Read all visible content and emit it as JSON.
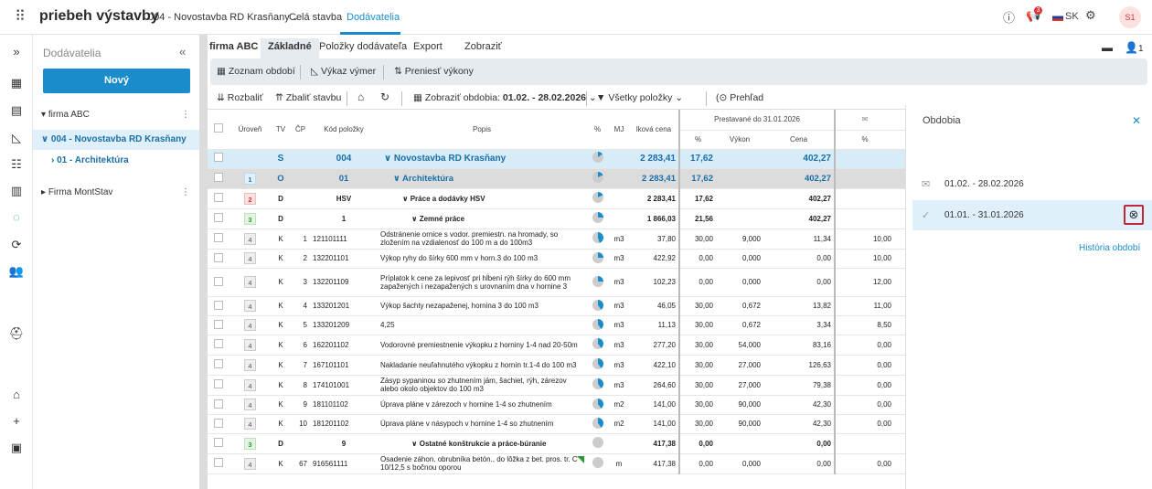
{
  "app": {
    "brand": "priebeh výstavby",
    "project": "004 - Novostavba RD Krasňany",
    "nav": [
      "Celá stavba",
      "Dodávatelia"
    ],
    "active_nav": "Dodávatelia",
    "badge_count": "3",
    "lang": "SK",
    "user": "S1"
  },
  "tree": {
    "header": "Dodávatelia",
    "new_button": "Nový",
    "nodes": [
      {
        "label": "firma ABC",
        "arrow": "▾",
        "dots": "⋮"
      },
      {
        "label": "004 - Novostavba RD Krasňany",
        "arrow": "∨"
      },
      {
        "label": "01 - Architektúra",
        "arrow": "›"
      },
      {
        "label": "Firma MontStav",
        "arrow": "▸",
        "dots": "⋮"
      }
    ]
  },
  "tabs": {
    "company": "firma ABC",
    "items": [
      "Základné",
      "Položky dodávateľa",
      "Export",
      "Zobraziť"
    ],
    "share_count": "1"
  },
  "toolbar1": {
    "periods": "Zoznam období",
    "measure": "Výkaz výmer",
    "transfer": "Preniesť výkony"
  },
  "toolbar2": {
    "expand": "Rozbaliť",
    "collapse": "Zbaliť stavbu",
    "show_period": "Zobraziť obdobia:",
    "period_value": "01.02. - 28.02.2026",
    "all_items": "Všetky položky",
    "overview": "Prehľad"
  },
  "table": {
    "headers": {
      "level": "Úroveň",
      "tv": "TV",
      "cp": "ČP",
      "code": "Kód položky",
      "desc": "Popis",
      "pct": "%",
      "mj": "MJ",
      "price_total": "lková cena",
      "performed_group": "Prestavané do 31.01.2026",
      "perf_pct": "%",
      "perf_out": "Výkon",
      "perf_price": "Cena",
      "next_pct": "%"
    },
    "rows": [
      {
        "type": "s",
        "lvl": "",
        "tv": "S",
        "cp": "",
        "code": "004",
        "desc": "Novostavba RD Krasňany",
        "pie": "p1",
        "mj": "",
        "price": "2 283,41",
        "pct": "17,62",
        "out": "",
        "cena": "402,27",
        "next": ""
      },
      {
        "type": "o",
        "lvl": "1",
        "lvlc": "l1",
        "tv": "O",
        "cp": "",
        "code": "01",
        "desc": "Architektúra",
        "pie": "p2",
        "mj": "",
        "price": "2 283,41",
        "pct": "17,62",
        "out": "",
        "cena": "402,27",
        "next": ""
      },
      {
        "type": "b",
        "lvl": "2",
        "lvlc": "l2",
        "tv": "D",
        "cp": "",
        "code": "HSV",
        "desc": "Práce a dodávky HSV",
        "pie": "p2",
        "mj": "",
        "price": "2 283,41",
        "pct": "17,62",
        "out": "",
        "cena": "402,27",
        "next": ""
      },
      {
        "type": "b",
        "lvl": "3",
        "lvlc": "l3",
        "tv": "D",
        "cp": "",
        "code": "1",
        "desc": "Zemné práce",
        "pie": "p3",
        "mj": "",
        "price": "1 866,03",
        "pct": "21,56",
        "out": "",
        "cena": "402,27",
        "next": ""
      },
      {
        "type": "k",
        "lvl": "4",
        "lvlc": "",
        "tv": "K",
        "cp": "1",
        "code": "121101111",
        "desc": "Odstránenie ornice s vodor. premiestn. na hromady, so zložením na vzdialenosť do 100 m a do 100m3",
        "pie": "p4",
        "mj": "m3",
        "price": "37,80",
        "pct": "30,00",
        "out": "9,000",
        "cena": "11,34",
        "next": "10,00"
      },
      {
        "type": "k",
        "lvl": "4",
        "lvlc": "",
        "tv": "K",
        "cp": "2",
        "code": "132201101",
        "desc": "Výkop ryhy do šírky 600 mm v horn.3 do 100 m3",
        "pie": "p3",
        "mj": "m3",
        "price": "422,92",
        "pct": "0,00",
        "out": "0,000",
        "cena": "0,00",
        "next": "10,00"
      },
      {
        "type": "k",
        "lvl": "4",
        "lvlc": "",
        "tv": "K",
        "cp": "3",
        "code": "132201109",
        "desc": "Príplatok k cene za lepivosť pri hĺbení rýh šírky do 600 mm zapažených i nezapažených s urovnaním dna v hornine 3",
        "pie": "p3",
        "mj": "m3",
        "price": "102,23",
        "pct": "0,00",
        "out": "0,000",
        "cena": "0,00",
        "next": "12,00"
      },
      {
        "type": "k",
        "lvl": "4",
        "lvlc": "",
        "tv": "K",
        "cp": "4",
        "code": "133201201",
        "desc": "Výkop šachty nezapaženej, hornina 3 do 100 m3",
        "pie": "p5",
        "mj": "m3",
        "price": "46,05",
        "pct": "30,00",
        "out": "0,672",
        "cena": "13,82",
        "next": "11,00"
      },
      {
        "type": "k",
        "lvl": "4",
        "lvlc": "",
        "tv": "K",
        "cp": "5",
        "code": "133201209",
        "desc": "4,25",
        "pie": "p5",
        "mj": "m3",
        "price": "11,13",
        "pct": "30,00",
        "out": "0,672",
        "cena": "3,34",
        "next": "8,50"
      },
      {
        "type": "k",
        "lvl": "4",
        "lvlc": "",
        "tv": "K",
        "cp": "6",
        "code": "162201102",
        "desc": "Vodorovné premiestnenie výkopku z horniny 1-4 nad 20-50m",
        "pie": "p5",
        "mj": "m3",
        "price": "277,20",
        "pct": "30,00",
        "out": "54,000",
        "cena": "83,16",
        "next": "0,00"
      },
      {
        "type": "k",
        "lvl": "4",
        "lvlc": "",
        "tv": "K",
        "cp": "7",
        "code": "167101101",
        "desc": "Nakladanie neuľahnutého výkopku z hornín tr.1-4 do 100 m3",
        "pie": "p5",
        "mj": "m3",
        "price": "422,10",
        "pct": "30,00",
        "out": "27,000",
        "cena": "126,63",
        "next": "0,00"
      },
      {
        "type": "k",
        "lvl": "4",
        "lvlc": "",
        "tv": "K",
        "cp": "8",
        "code": "174101001",
        "desc": "Zásyp sypaninou so zhutnením jám, šachiet, rýh, zárezov alebo okolo objektov do 100 m3",
        "pie": "p5",
        "mj": "m3",
        "price": "264,60",
        "pct": "30,00",
        "out": "27,000",
        "cena": "79,38",
        "next": "0,00"
      },
      {
        "type": "k",
        "lvl": "4",
        "lvlc": "",
        "tv": "K",
        "cp": "9",
        "code": "181101102",
        "desc": "Úprava pláne v zárezoch v hornine 1-4 so zhutnením",
        "pie": "p5",
        "mj": "m2",
        "price": "141,00",
        "pct": "30,00",
        "out": "90,000",
        "cena": "42,30",
        "next": "0,00"
      },
      {
        "type": "k",
        "lvl": "4",
        "lvlc": "",
        "tv": "K",
        "cp": "10",
        "code": "181201102",
        "desc": "Úprava pláne v násypoch v hornine 1-4 so zhutnením",
        "pie": "p5",
        "mj": "m2",
        "price": "141,00",
        "pct": "30,00",
        "out": "90,000",
        "cena": "42,30",
        "next": "0,00"
      },
      {
        "type": "b",
        "lvl": "3",
        "lvlc": "l3",
        "tv": "D",
        "cp": "",
        "code": "9",
        "desc": "Ostatné konštrukcie a práce-búranie",
        "pie": "p0",
        "mj": "",
        "price": "417,38",
        "pct": "0,00",
        "out": "",
        "cena": "0,00",
        "next": ""
      },
      {
        "type": "k",
        "lvl": "4",
        "lvlc": "",
        "tv": "K",
        "cp": "67",
        "code": "916561111",
        "desc": "Osadenie záhon. obrubníka betón., do lôžka z bet. pros. tr. C 10/12,5 s bočnou oporou",
        "pie": "p0",
        "mj": "m",
        "price": "417,38",
        "pct": "0,00",
        "out": "0,000",
        "cena": "0,00",
        "next": "0,00",
        "corner": true
      }
    ]
  },
  "panel": {
    "title": "Obdobia",
    "periods": [
      "01.02. - 28.02.2026",
      "01.01. - 31.01.2026"
    ],
    "history": "História období"
  }
}
